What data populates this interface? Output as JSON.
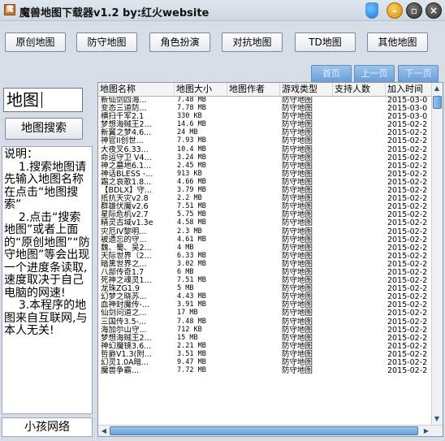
{
  "window": {
    "title": "魔兽地图下载器v1.2   by:红火website",
    "app_icon_glyph": "魔"
  },
  "categories": [
    {
      "label": "原创地图"
    },
    {
      "label": "防守地图"
    },
    {
      "label": "角色扮演"
    },
    {
      "label": "对抗地图"
    },
    {
      "label": "TD地图"
    },
    {
      "label": "其他地图"
    }
  ],
  "pager": {
    "first": "首页",
    "prev": "上一页",
    "next": "下一页"
  },
  "search": {
    "value": "地图",
    "button": "地图搜索"
  },
  "help_text": "说明：\n    1.搜索地图请先输入地图名称在点击“地图搜索”\n    2.点击“搜索地图”或者上面的“原创地图”“防守地图”等会出现一个进度条读取,速度取决于自己电脑的网速!\n    3.本程序的地图来自互联网,与本人无关!",
  "footer": "小孩网络",
  "table": {
    "columns": [
      "地图名称",
      "地图大小",
      "地图作者",
      "游戏类型",
      "支持人数",
      "加入时间"
    ],
    "rows": [
      [
        "新仙剑四海...",
        "7.48 MB",
        "",
        "防守地图",
        "",
        "2015-03-0"
      ],
      [
        "变态三道防...",
        "7.78 MB",
        "",
        "防守地图",
        "",
        "2015-03-0"
      ],
      [
        "横扫千军2.1",
        "330 KB",
        "",
        "防守地图",
        "",
        "2015-03-0"
      ],
      [
        "梦想海贼王2...",
        "14.6 MB",
        "",
        "防守地图",
        "",
        "2015-02-2"
      ],
      [
        "新翼之梦4.6...",
        "24 MB",
        "",
        "防守地图",
        "",
        "2015-02-2"
      ],
      [
        "神官II创世...",
        "7.93 MB",
        "",
        "防守地图",
        "",
        "2015-02-2"
      ],
      [
        "大夜叉6.33...",
        "10.4 MB",
        "",
        "防守地图",
        "",
        "2015-02-2"
      ],
      [
        "命运守卫 V4...",
        "3.24 MB",
        "",
        "防守地图",
        "",
        "2015-02-2"
      ],
      [
        "神之墓地6.1...",
        "2.45 MB",
        "",
        "防守地图",
        "",
        "2015-02-2"
      ],
      [
        "神话BLESS -...",
        "913 KB",
        "",
        "防守地图",
        "",
        "2015-02-2"
      ],
      [
        "霜之哀歌1.8...",
        "4.66 MB",
        "",
        "防守地图",
        "",
        "2015-02-2"
      ],
      [
        "【BDLX】守...",
        "3.79 MB",
        "",
        "防守地图",
        "",
        "2015-02-2"
      ],
      [
        "抵抗天灾v2.8",
        "2.2 MB",
        "",
        "防守地图",
        "",
        "2015-02-2"
      ],
      [
        "群雄伏魔v2.6",
        "7.51 MB",
        "",
        "防守地图",
        "",
        "2015-02-2"
      ],
      [
        "星际危机v2.7",
        "5.75 MB",
        "",
        "防守地图",
        "",
        "2015-02-2"
      ],
      [
        "精灵古域v1.3e",
        "4.58 MB",
        "",
        "防守地图",
        "",
        "2015-02-2"
      ],
      [
        "灾厄IV黎明...",
        "2.3 MB",
        "",
        "防守地图",
        "",
        "2015-02-2"
      ],
      [
        "被遗忘的守...",
        "4.61 MB",
        "",
        "防守地图",
        "",
        "2015-02-2"
      ],
      [
        "魏、蜀、吴2...",
        "4 MB",
        "",
        "防守地图",
        "",
        "2015-02-2"
      ],
      [
        "天际世界（2...",
        "6.33 MB",
        "",
        "防守地图",
        "",
        "2015-02-2"
      ],
      [
        "暗黑世界之...",
        "3.02 MB",
        "",
        "防守地图",
        "",
        "2015-02-2"
      ],
      [
        "八部传奇1.7",
        "6 MB",
        "",
        "防守地图",
        "",
        "2015-02-2"
      ],
      [
        "死神之魂灵1...",
        "7.51 MB",
        "",
        "防守地图",
        "",
        "2015-02-2"
      ],
      [
        "龙珠ZG1.9",
        "5 MB",
        "",
        "防守地图",
        "",
        "2015-02-2"
      ],
      [
        "幻梦之晓苏...",
        "4.43 MB",
        "",
        "防守地图",
        "",
        "2015-02-2"
      ],
      [
        "血神封魔传-...",
        "3.91 MB",
        "",
        "防守地图",
        "",
        "2015-02-2"
      ],
      [
        "仙剑问道之...",
        "17 MB",
        "",
        "防守地图",
        "",
        "2015-02-2"
      ],
      [
        "三国传3.5-...",
        "7.48 MB",
        "",
        "防守地图",
        "",
        "2015-02-2"
      ],
      [
        "海加尔山守...",
        "712 KB",
        "",
        "防守地图",
        "",
        "2015-02-2"
      ],
      [
        "梦想海贼王2...",
        "15 MB",
        "",
        "防守地图",
        "",
        "2015-02-2"
      ],
      [
        "神幻魔镜3.6...",
        "2.21 MB",
        "",
        "防守地图",
        "",
        "2015-02-2"
      ],
      [
        "哲爵V1.3(附...",
        "3.51 MB",
        "",
        "防守地图",
        "",
        "2015-02-2"
      ],
      [
        "幻灵1.0A暗...",
        "9.47 MB",
        "",
        "防守地图",
        "",
        "2015-02-2"
      ],
      [
        "魔兽争霸...",
        "7.72 MB",
        "",
        "防守地图",
        "",
        "2015-02-2"
      ]
    ]
  }
}
